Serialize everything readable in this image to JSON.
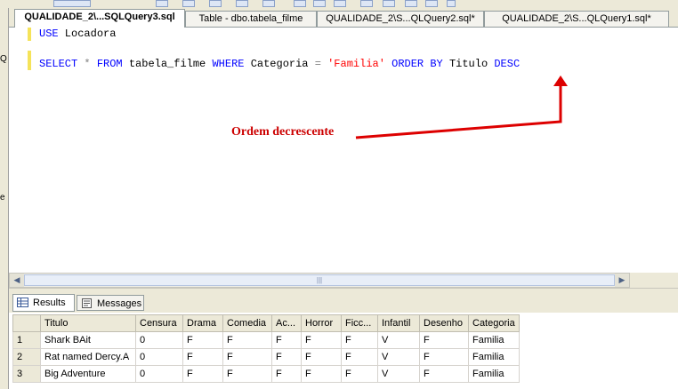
{
  "toolbar": {
    "icons": [
      "execute-icon",
      "check-icon",
      "table-icon",
      "grid-icon",
      "text-icon",
      "file-icon",
      "results-icon",
      "comment-icon",
      "uncomment-icon",
      "indent-icon",
      "outdent-icon",
      "dropdown-icon"
    ]
  },
  "left_panel": {
    "frag1": "Q",
    "frag2": "e"
  },
  "tabs": [
    {
      "label": "QUALIDADE_2\\...SQLQuery3.sql",
      "active": true
    },
    {
      "label": "Table - dbo.tabela_filme",
      "active": false
    },
    {
      "label": "QUALIDADE_2\\S...QLQuery2.sql*",
      "active": false
    },
    {
      "label": "QUALIDADE_2\\S...QLQuery1.sql*",
      "active": false
    }
  ],
  "editor": {
    "line1": {
      "kw1": "USE",
      "rest": " Locadora"
    },
    "line2": {
      "k_select": "SELECT",
      "star": "*",
      "k_from": "FROM",
      "table": "tabela_filme",
      "k_where": "WHERE",
      "col": "Categoria",
      "eq": "=",
      "str": "'Familia'",
      "k_order": "ORDER BY",
      "sortcol": "Titulo",
      "k_desc": "DESC"
    }
  },
  "annotation": {
    "text": "Ordem decrescente",
    "color": "#cc0000"
  },
  "results_tabs": [
    {
      "label": "Results",
      "active": true
    },
    {
      "label": "Messages",
      "active": false
    }
  ],
  "grid": {
    "columns": [
      "Titulo",
      "Censura",
      "Drama",
      "Comedia",
      "Ac...",
      "Horror",
      "Ficc...",
      "Infantil",
      "Desenho",
      "Categoria"
    ],
    "rows": [
      [
        "1",
        "Shark BAit",
        "0",
        "F",
        "F",
        "F",
        "F",
        "F",
        "V",
        "F",
        "Familia"
      ],
      [
        "2",
        "Rat named Dercy.A",
        "0",
        "F",
        "F",
        "F",
        "F",
        "F",
        "V",
        "F",
        "Familia"
      ],
      [
        "3",
        "Big Adventure",
        "0",
        "F",
        "F",
        "F",
        "F",
        "F",
        "V",
        "F",
        "Familia"
      ]
    ]
  },
  "colors": {
    "keyword": "#0000ff",
    "string": "#ff0000",
    "operator": "#808080",
    "annotation": "#cc0000"
  }
}
